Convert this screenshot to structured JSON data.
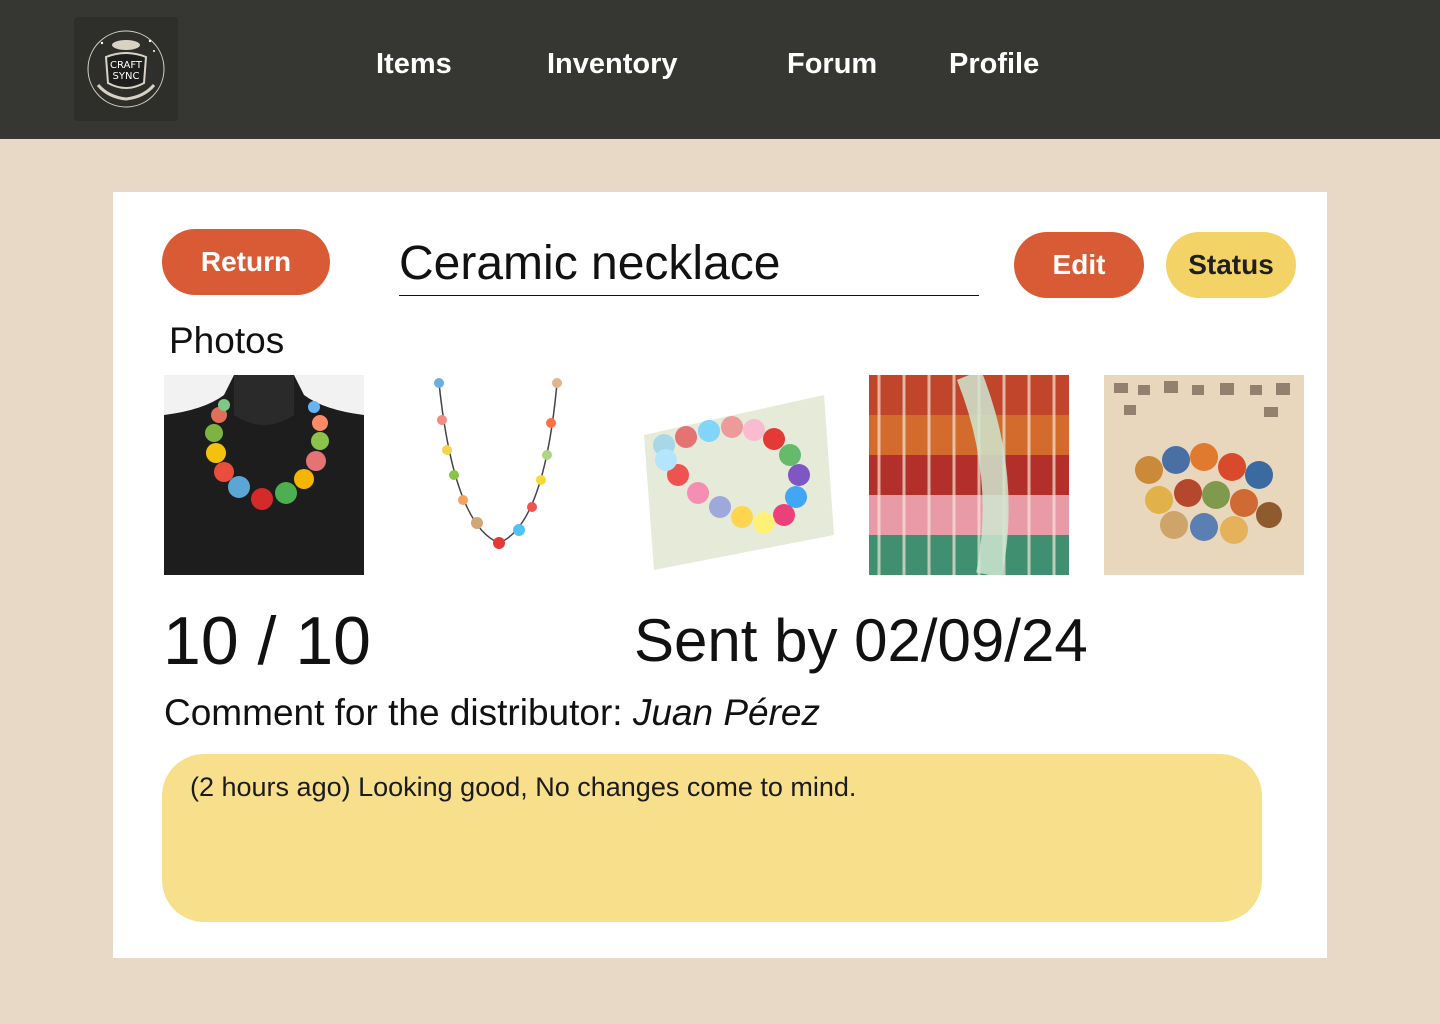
{
  "brand": {
    "logo_text_line1": "CRAFT",
    "logo_text_line2": "SYNC",
    "icon": "cauldron-logo-icon"
  },
  "nav": {
    "items": [
      {
        "label": "Items"
      },
      {
        "label": "Inventory"
      },
      {
        "label": "Forum"
      },
      {
        "label": "Profile"
      }
    ]
  },
  "item": {
    "return_label": "Return",
    "title": "Ceramic necklace",
    "edit_label": "Edit",
    "status_label": "Status",
    "photos_label": "Photos",
    "photos": [
      {
        "alt": "Ceramic bead necklace on black bust"
      },
      {
        "alt": "Ceramic bead necklace on white background"
      },
      {
        "alt": "Glossy ceramic beads strand"
      },
      {
        "alt": "Multiple strands of striped ceramic beads"
      },
      {
        "alt": "Loose ceramic beads on calligraphy paper"
      }
    ],
    "quantity": "10 / 10",
    "sent_by": "Sent by 02/09/24",
    "comment_label": "Comment for the distributor:",
    "distributor": "Juan Pérez",
    "comment": "(2 hours ago) Looking good, No changes come to mind."
  },
  "colors": {
    "topbar": "#363732",
    "background": "#e8d9c7",
    "accent_orange": "#d95b36",
    "accent_yellow": "#f3d366",
    "comment_bg": "#f7df8c"
  }
}
